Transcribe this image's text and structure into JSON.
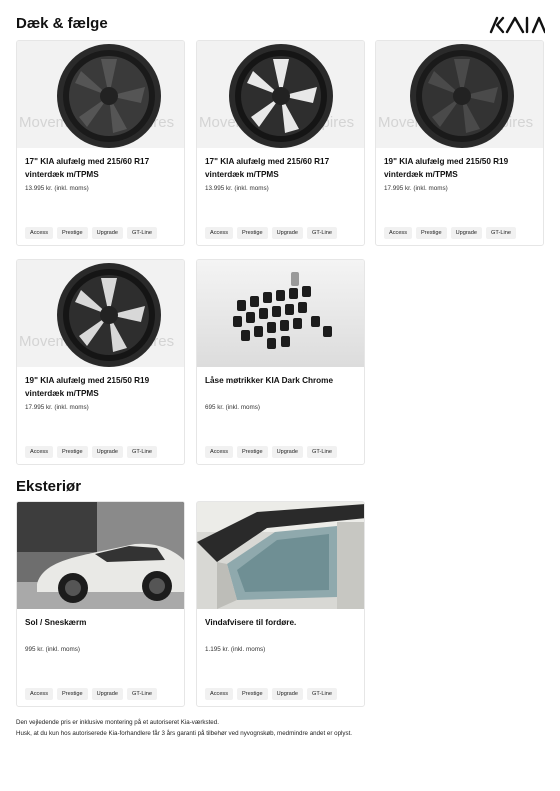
{
  "sections": {
    "wheels_title": "Dæk & fælge",
    "exterior_title": "Eksteriør"
  },
  "brand": {
    "logo_text": "KIA"
  },
  "watermark": {
    "text": "Movement that inspires"
  },
  "tags": [
    "Access",
    "Prestige",
    "Upgrade",
    "GT-Line"
  ],
  "products": [
    {
      "name": "17\" KIA alufælg med 215/60 R17 vinterdæk m/TPMS",
      "price": "13.995 kr. (inkl. moms)",
      "image": "wheel-dark-icon"
    },
    {
      "name": "17\" KIA alufælg med 215/60 R17 vinterdæk m/TPMS",
      "price": "13.995 kr. (inkl. moms)",
      "image": "wheel-polished-icon"
    },
    {
      "name": "19\" KIA alufælg med 215/50 R19 vinterdæk m/TPMS",
      "price": "17.995 kr. (inkl. moms)",
      "image": "wheel-dark-icon"
    },
    {
      "name": "19\" KIA alufælg med 215/50 R19 vinterdæk m/TPMS",
      "price": "17.995 kr. (inkl. moms)",
      "image": "wheel-polished-icon"
    },
    {
      "name": "Låse møtrikker KIA Dark Chrome",
      "price": "695 kr. (inkl. moms)",
      "image": "lug-nuts-icon"
    },
    {
      "name": "Sol / Sneskærm",
      "price": "995 kr. (inkl. moms)",
      "image": "car-photo"
    },
    {
      "name": "Vindafvisere til fordøre.",
      "price": "1.195 kr. (inkl. moms)",
      "image": "window-deflector-photo"
    }
  ],
  "footer": {
    "line1": "Den vejledende pris er inklusive montering på et autoriseret Kia-værksted.",
    "line2": "Husk, at du kun hos autoriserede Kia-forhandlere får 3 års garanti på tilbehør ved nyvognskøb, medmindre andet er oplyst."
  }
}
